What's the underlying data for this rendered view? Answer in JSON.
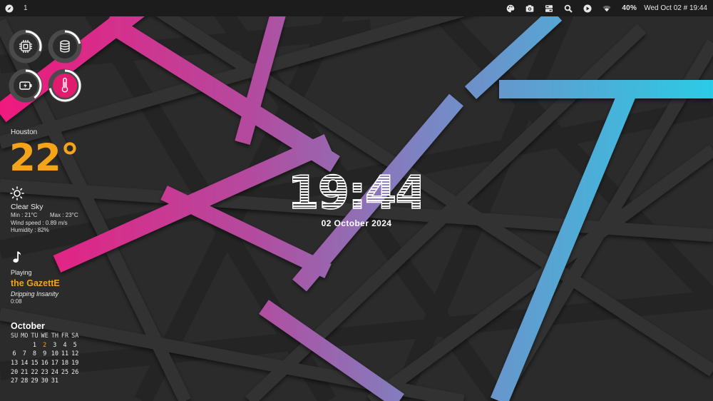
{
  "topbar": {
    "workspace": "1",
    "battery": "40%",
    "datetime": "Wed Oct 02 # 19:44"
  },
  "gauges": [
    {
      "name": "cpu",
      "icon": "cpu-chip-icon",
      "level": 0.3
    },
    {
      "name": "storage",
      "icon": "database-icon",
      "level": 0.22
    },
    {
      "name": "battery",
      "icon": "battery-charging-icon",
      "level": 0.4
    },
    {
      "name": "temperature",
      "icon": "thermometer-icon",
      "level": 0.72
    }
  ],
  "weather": {
    "city": "Houston",
    "temp": "22°",
    "icon": "sun-icon",
    "condition": "Clear Sky",
    "min": "Min : 21°C",
    "max": "Max : 23°C",
    "wind": "Wind speed : 0.89 m/s",
    "humidity": "Humidity : 82%"
  },
  "music": {
    "icon": "music-note-icon",
    "status": "Playing",
    "artist": "the GazettE",
    "track": "Dripping Insanity",
    "elapsed": "0:08"
  },
  "calendar": {
    "month": "October",
    "weekdays": [
      "SU",
      "MO",
      "TU",
      "WE",
      "TH",
      "FR",
      "SA"
    ],
    "weeks": [
      [
        "",
        "",
        "1",
        "2",
        "3",
        "4",
        "5"
      ],
      [
        "6",
        "7",
        "8",
        "9",
        "10",
        "11",
        "12"
      ],
      [
        "13",
        "14",
        "15",
        "16",
        "17",
        "18",
        "19"
      ],
      [
        "20",
        "21",
        "22",
        "23",
        "24",
        "25",
        "26"
      ],
      [
        "27",
        "28",
        "29",
        "30",
        "31",
        "",
        ""
      ]
    ],
    "today": "2"
  },
  "clock": {
    "time": "19:44",
    "date": "02 October 2024"
  },
  "colors": {
    "accent": "#f5a318",
    "bar": "#1c1c1c",
    "gauge_track": "#4a4a4a",
    "gauge_fill": "#ffffff"
  }
}
